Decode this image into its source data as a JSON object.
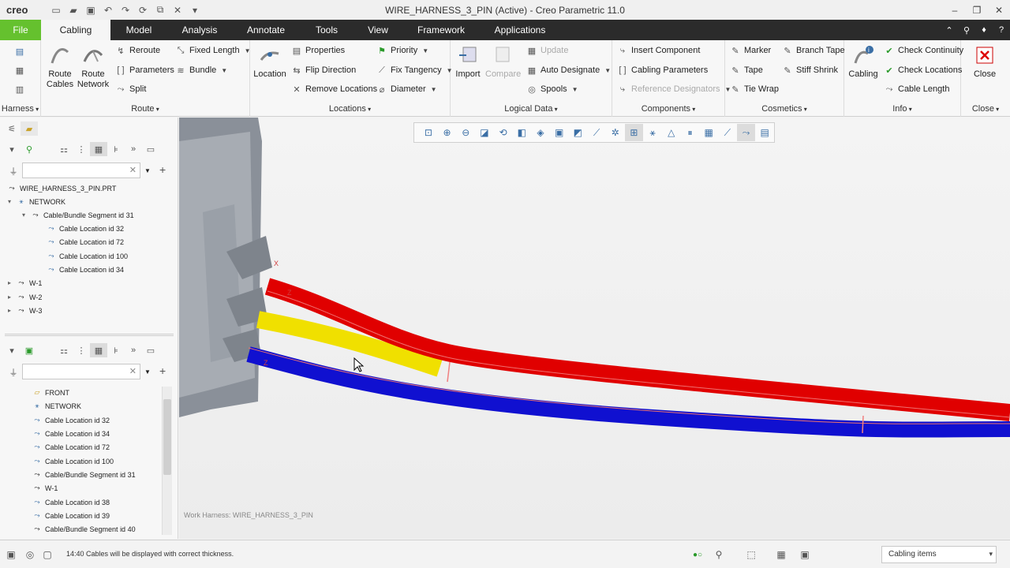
{
  "window": {
    "logo": "creo",
    "title": "WIRE_HARNESS_3_PIN (Active) - Creo Parametric 11.0"
  },
  "tabs": [
    "File",
    "Cabling",
    "Model",
    "Analysis",
    "Annotate",
    "Tools",
    "View",
    "Framework",
    "Applications"
  ],
  "ribbon": {
    "harness": {
      "label": "Harness"
    },
    "route": {
      "label": "Route",
      "route_cables": [
        "Route",
        "Cables"
      ],
      "route_network": [
        "Route",
        "Network"
      ],
      "reroute": "Reroute",
      "parameters": "Parameters",
      "split": "Split",
      "fixed_length": "Fixed Length",
      "bundle": "Bundle"
    },
    "locations": {
      "label": "Locations",
      "location": "Location",
      "properties": "Properties",
      "flip_direction": "Flip Direction",
      "remove_locations": "Remove Locations",
      "priority": "Priority",
      "fix_tangency": "Fix Tangency",
      "diameter": "Diameter"
    },
    "logical_data": {
      "label": "Logical Data",
      "import": "Import",
      "compare": "Compare",
      "update": "Update",
      "auto_designate": "Auto Designate",
      "spools": "Spools"
    },
    "components": {
      "label": "Components",
      "insert_component": "Insert Component",
      "cabling_parameters": "Cabling Parameters",
      "reference_designators": "Reference Designators"
    },
    "cosmetics": {
      "label": "Cosmetics",
      "marker": "Marker",
      "tape": "Tape",
      "tie_wrap": "Tie Wrap",
      "branch_tape": "Branch Tape",
      "stiff_shrink": "Stiff Shrink"
    },
    "info": {
      "label": "Info",
      "cabling": "Cabling",
      "check_continuity": "Check Continuity",
      "check_locations": "Check Locations",
      "cable_length": "Cable Length"
    },
    "close": {
      "label": "Close",
      "button": "Close"
    }
  },
  "tree_top": {
    "root": "WIRE_HARNESS_3_PIN.PRT",
    "network": "NETWORK",
    "segment": "Cable/Bundle Segment id 31",
    "locations": [
      "Cable Location id 32",
      "Cable Location id 72",
      "Cable Location id 100",
      "Cable Location id 34"
    ],
    "wires": [
      "W-1",
      "W-2",
      "W-3"
    ]
  },
  "tree_bottom": [
    "FRONT",
    "NETWORK",
    "Cable Location id 32",
    "Cable Location id 34",
    "Cable Location id 72",
    "Cable Location id 100",
    "Cable/Bundle Segment id 31",
    "W-1",
    "Cable Location id 38",
    "Cable Location id 39",
    "Cable/Bundle Segment id 40"
  ],
  "viewport": {
    "work_harness": "Work Harness: WIRE_HARNESS_3_PIN",
    "axis_labels": [
      "X",
      "Z",
      "Z"
    ],
    "cable_colors": {
      "red": "#e00000",
      "yellow": "#f0e000",
      "blue": "#1010d0"
    }
  },
  "status": {
    "message": "14:40 Cables will be displayed with correct thickness.",
    "filter_value": "Cabling items"
  }
}
